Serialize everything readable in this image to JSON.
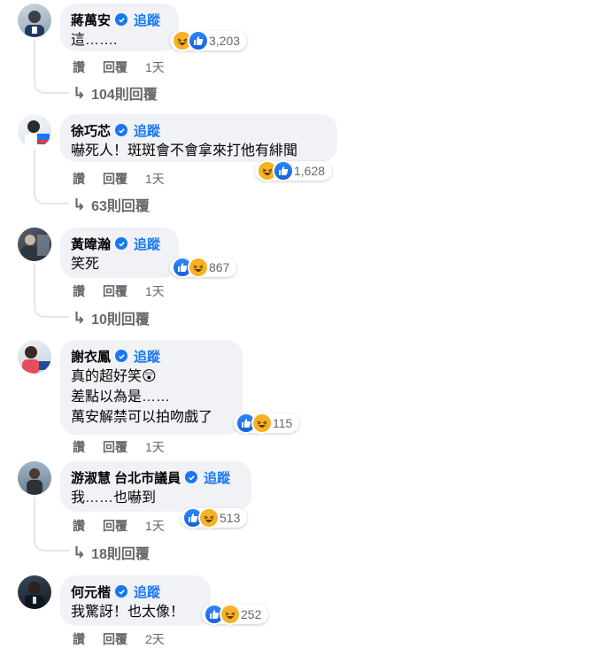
{
  "ui": {
    "follow_label": "追蹤",
    "like_label": "讚",
    "reply_label": "回覆"
  },
  "colors": {
    "link_blue": "#1877f2",
    "bubble_gray": "#f0f2f5",
    "meta_gray": "#65676b"
  },
  "comments": [
    {
      "name": "蔣萬安",
      "lines": [
        "這……."
      ],
      "reactions": [
        "haha-icon",
        "like-icon"
      ],
      "reaction_count": "3,203",
      "time": "1天",
      "replies": "104則回覆"
    },
    {
      "name": "徐巧芯",
      "lines": [
        "嚇死人！斑斑會不會拿來打他有緋聞"
      ],
      "reactions": [
        "haha-icon",
        "like-icon"
      ],
      "reaction_count": "1,628",
      "time": "1天",
      "replies": "63則回覆"
    },
    {
      "name": "黃暐瀚",
      "lines": [
        "笑死"
      ],
      "reactions": [
        "like-icon",
        "haha-icon"
      ],
      "reaction_count": "867",
      "time": "1天",
      "replies": "10則回覆"
    },
    {
      "name": "謝衣鳳",
      "lines": [
        "真的超好笑😲",
        "差點以為是……",
        "萬安解禁可以拍吻戲了"
      ],
      "reactions": [
        "like-icon",
        "haha-icon"
      ],
      "reaction_count": "115",
      "time": "1天",
      "replies": ""
    },
    {
      "name": "游淑慧 台北市議員",
      "lines": [
        "我……也嚇到"
      ],
      "reactions": [
        "like-icon",
        "haha-icon"
      ],
      "reaction_count": "513",
      "time": "1天",
      "replies": "18則回覆"
    },
    {
      "name": "何元楷",
      "lines": [
        "我驚訝！也太像！"
      ],
      "reactions": [
        "like-icon",
        "haha-icon"
      ],
      "reaction_count": "252",
      "time": "2天",
      "replies": ""
    }
  ]
}
